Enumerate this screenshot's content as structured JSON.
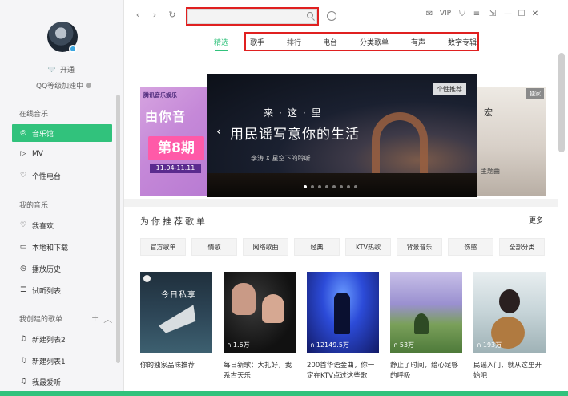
{
  "account": {
    "vip_label": "开通",
    "qq_level_label": "QQ等级加速中"
  },
  "sidebar": {
    "section_online": "在线音乐",
    "online_items": [
      {
        "label": "音乐馆",
        "icon": "music-hall-icon",
        "active": true
      },
      {
        "label": "MV",
        "icon": "mv-play-icon",
        "active": false
      },
      {
        "label": "个性电台",
        "icon": "radio-heart-icon",
        "active": false
      }
    ],
    "section_mine": "我的音乐",
    "mine_items": [
      {
        "label": "我喜欢",
        "icon": "heart-icon"
      },
      {
        "label": "本地和下载",
        "icon": "monitor-icon"
      },
      {
        "label": "播放历史",
        "icon": "history-clock-icon"
      },
      {
        "label": "试听列表",
        "icon": "queue-list-icon"
      }
    ],
    "section_created": "我创建的歌单",
    "created_items": [
      {
        "label": "新建列表2",
        "icon": "note-icon"
      },
      {
        "label": "新建列表1",
        "icon": "note-icon"
      },
      {
        "label": "我最爱听",
        "icon": "note-icon"
      }
    ]
  },
  "search": {
    "value": "",
    "placeholder": ""
  },
  "header": {
    "vip_badge": "VIP"
  },
  "tabs": [
    {
      "label": "精选",
      "active": true
    },
    {
      "label": "歌手",
      "active": false
    },
    {
      "label": "排行",
      "active": false
    },
    {
      "label": "电台",
      "active": false
    },
    {
      "label": "分类歌单",
      "active": false
    },
    {
      "label": "有声",
      "active": false
    },
    {
      "label": "数字专辑",
      "active": false
    }
  ],
  "banner": {
    "left": {
      "logo": "腾讯音乐娱乐",
      "show": "由你音",
      "episode": "第8期",
      "dates": "11.04-11.11"
    },
    "main": {
      "line1": "来·这·里",
      "line2": "用民谣写意你的生活",
      "subtitle": "李涛 X 星空下的聆听",
      "tag": "个性推荐"
    },
    "right": {
      "badge": "独家",
      "title": "宏",
      "theme": "主题曲"
    },
    "dot_count": 8,
    "active_dot": 0
  },
  "recommend": {
    "title": "为你推荐歌单",
    "more": "更多",
    "categories": [
      "官方歌单",
      "情歌",
      "网络歌曲",
      "经典",
      "KTV热歌",
      "背景音乐",
      "伤感",
      "全部分类"
    ],
    "cards": [
      {
        "cover_text": "今日私享",
        "plays": "",
        "title": "你的独家品味推荐"
      },
      {
        "cover_text": "",
        "plays": "1.6万",
        "title": "每日新歌：大扎好，我系古天乐"
      },
      {
        "cover_text": "",
        "plays": "12149.5万",
        "title": "200首华语金曲，你一定在KTV点过这些歌"
      },
      {
        "cover_text": "",
        "plays": "53万",
        "title": "静止了时间，给心足够的呼吸"
      },
      {
        "cover_text": "",
        "plays": "193万",
        "title": "民谣入门，就从这里开始吧"
      }
    ]
  },
  "colors": {
    "accent": "#31c27c",
    "highlight_box": "#e02020"
  }
}
